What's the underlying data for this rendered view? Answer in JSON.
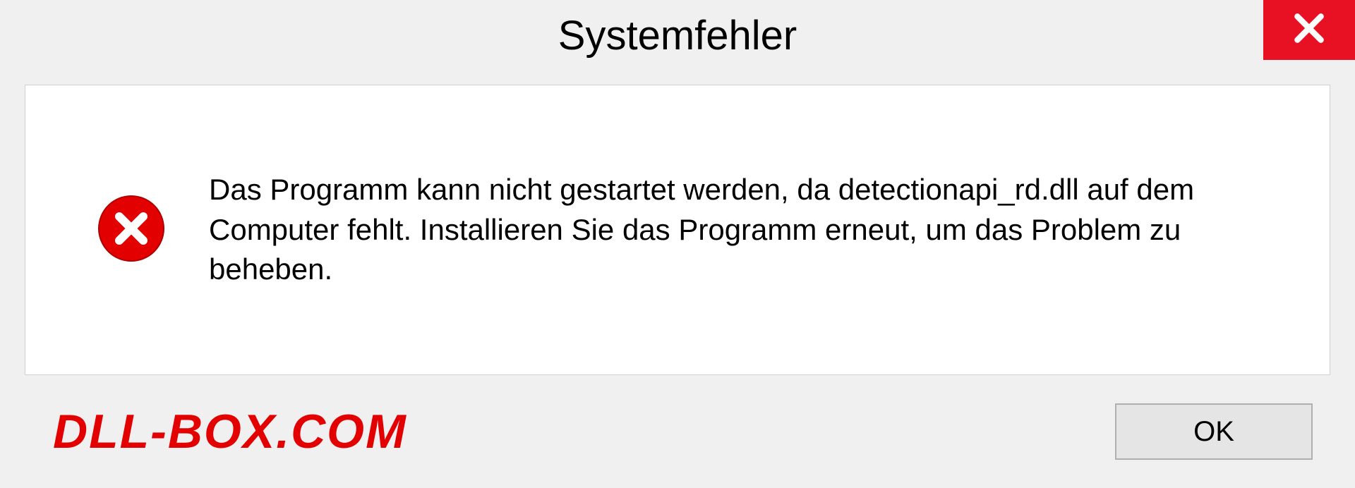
{
  "dialog": {
    "title": "Systemfehler",
    "message": "Das Programm kann nicht gestartet werden, da detectionapi_rd.dll auf dem Computer fehlt. Installieren Sie das Programm erneut, um das Problem zu beheben.",
    "ok_label": "OK"
  },
  "watermark": "DLL-BOX.COM"
}
